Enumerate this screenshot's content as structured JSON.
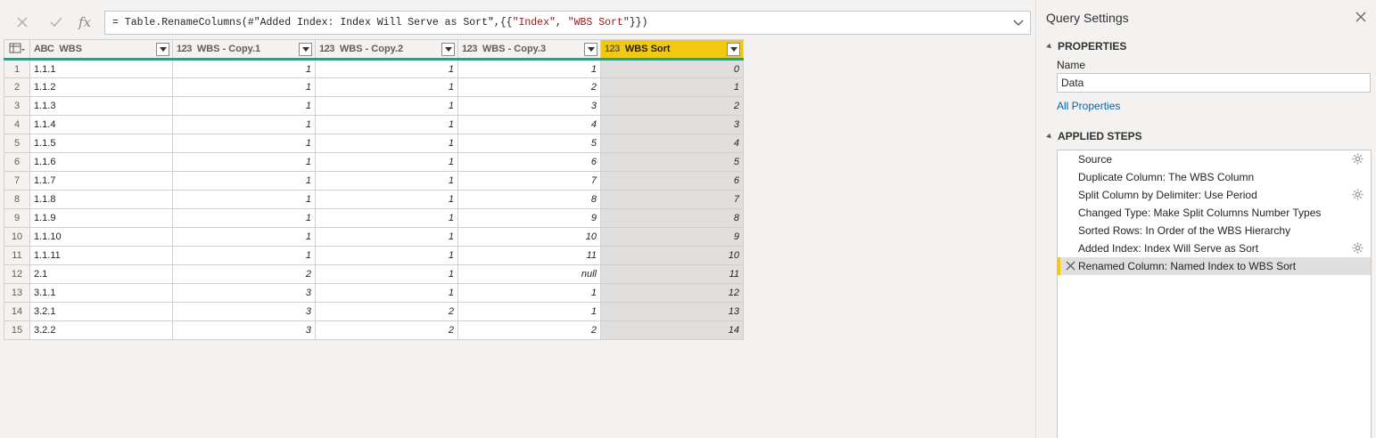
{
  "formula": {
    "cancel_icon": "close-icon",
    "confirm_icon": "check-icon",
    "fx_label": "fx",
    "prefix": "= Table.RenameColumns(#\"Added Index: Index Will Serve as Sort\",{{",
    "str1": "\"Index\"",
    "sep": ", ",
    "str2": "\"WBS Sort\"",
    "suffix": "}})"
  },
  "grid": {
    "columns": [
      {
        "type_icon": "ABC",
        "label": "WBS"
      },
      {
        "type_icon": "123",
        "label": "WBS - Copy.1"
      },
      {
        "type_icon": "123",
        "label": "WBS - Copy.2"
      },
      {
        "type_icon": "123",
        "label": "WBS - Copy.3"
      },
      {
        "type_icon": "123",
        "label": "WBS Sort"
      }
    ],
    "rows": [
      [
        "1",
        "1.1.1",
        "1",
        "1",
        "1",
        "0"
      ],
      [
        "2",
        "1.1.2",
        "1",
        "1",
        "2",
        "1"
      ],
      [
        "3",
        "1.1.3",
        "1",
        "1",
        "3",
        "2"
      ],
      [
        "4",
        "1.1.4",
        "1",
        "1",
        "4",
        "3"
      ],
      [
        "5",
        "1.1.5",
        "1",
        "1",
        "5",
        "4"
      ],
      [
        "6",
        "1.1.6",
        "1",
        "1",
        "6",
        "5"
      ],
      [
        "7",
        "1.1.7",
        "1",
        "1",
        "7",
        "6"
      ],
      [
        "8",
        "1.1.8",
        "1",
        "1",
        "8",
        "7"
      ],
      [
        "9",
        "1.1.9",
        "1",
        "1",
        "9",
        "8"
      ],
      [
        "10",
        "1.1.10",
        "1",
        "1",
        "10",
        "9"
      ],
      [
        "11",
        "1.1.11",
        "1",
        "1",
        "11",
        "10"
      ],
      [
        "12",
        "2.1",
        "2",
        "1",
        "null",
        "11"
      ],
      [
        "13",
        "3.1.1",
        "3",
        "1",
        "1",
        "12"
      ],
      [
        "14",
        "3.2.1",
        "3",
        "2",
        "1",
        "13"
      ],
      [
        "15",
        "3.2.2",
        "3",
        "2",
        "2",
        "14"
      ]
    ]
  },
  "pane": {
    "title": "Query Settings",
    "properties_header": "PROPERTIES",
    "name_label": "Name",
    "name_value": "Data",
    "all_properties_link": "All Properties",
    "applied_steps_header": "APPLIED STEPS",
    "steps": [
      {
        "label": "Source",
        "gear": true
      },
      {
        "label": "Duplicate Column: The WBS Column",
        "gear": false
      },
      {
        "label": "Split Column by Delimiter: Use Period",
        "gear": true
      },
      {
        "label": "Changed Type: Make Split Columns Number Types",
        "gear": false
      },
      {
        "label": "Sorted Rows: In Order of the WBS Hierarchy",
        "gear": false
      },
      {
        "label": "Added Index: Index Will Serve as Sort",
        "gear": true
      },
      {
        "label": "Renamed Column: Named Index to WBS Sort",
        "gear": false,
        "active": true
      }
    ]
  },
  "colors": {
    "accent": "#f2c811",
    "teal": "#00b294",
    "link": "#0063b1"
  }
}
